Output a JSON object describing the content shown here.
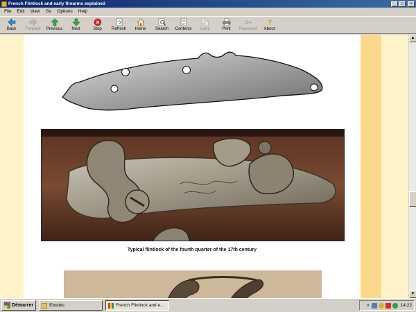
{
  "window": {
    "title": "French Flintlock and early firearms explained",
    "controls": {
      "minimize": "_",
      "maximize": "□",
      "close": "×"
    }
  },
  "menu": [
    "File",
    "Edit",
    "View",
    "Go",
    "Options",
    "Help"
  ],
  "toolbar": [
    {
      "label": "Back",
      "icon": "arrow-left-icon",
      "enabled": true
    },
    {
      "label": "Forward",
      "icon": "arrow-right-icon",
      "enabled": false
    },
    {
      "label": "Previous",
      "icon": "arrow-up-icon",
      "enabled": true
    },
    {
      "label": "Next",
      "icon": "arrow-down-icon",
      "enabled": true
    },
    {
      "label": "Stop",
      "icon": "stop-icon",
      "enabled": true
    },
    {
      "label": "Refresh",
      "icon": "refresh-icon",
      "enabled": true
    },
    {
      "label": "Home",
      "icon": "home-icon",
      "enabled": true
    },
    {
      "label": "Search",
      "icon": "search-icon",
      "enabled": true
    },
    {
      "label": "Contents",
      "icon": "contents-icon",
      "enabled": true
    },
    {
      "label": "Copy",
      "icon": "copy-icon",
      "enabled": false
    },
    {
      "label": "Print",
      "icon": "print-icon",
      "enabled": true
    },
    {
      "label": "Password",
      "icon": "key-icon",
      "enabled": false
    },
    {
      "label": "About",
      "icon": "help-icon",
      "enabled": true
    }
  ],
  "content": {
    "caption": "Typical flintlock of the fourth quarter of the 17th century"
  },
  "taskbar": {
    "start_label": "Démarrer",
    "tasks": [
      {
        "label": "Ebooks",
        "active": false
      },
      {
        "label": "French Flintlock and e...",
        "active": true
      }
    ],
    "tray_prefix": "«",
    "clock": "14:22"
  },
  "colors": {
    "titlebar_start": "#0a246a",
    "titlebar_end": "#3a6ea5",
    "page_background": "#fdf2c8",
    "accent_band": "#fad98a"
  }
}
